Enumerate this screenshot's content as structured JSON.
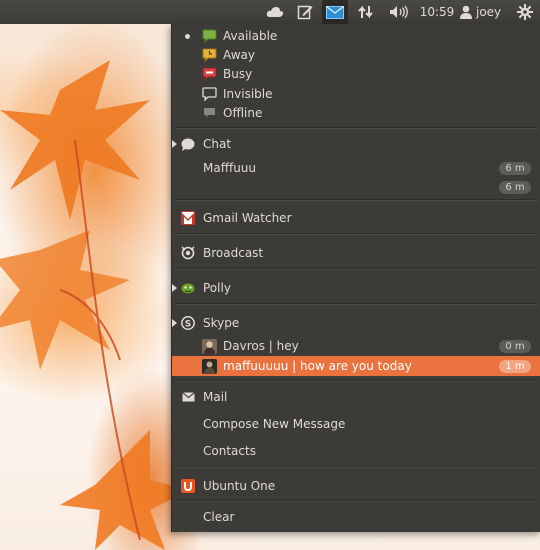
{
  "panel": {
    "clock": "10:59",
    "user": "joey",
    "icons": [
      "cloud-icon",
      "compose-icon",
      "envelope-icon",
      "network-icon",
      "volume-icon",
      "user-icon",
      "gear-icon"
    ]
  },
  "status": {
    "items": [
      {
        "label": "Available",
        "icon": "available-status-icon",
        "color": "#7cb342",
        "selected": true
      },
      {
        "label": "Away",
        "icon": "away-status-icon",
        "color": "#e3b33c"
      },
      {
        "label": "Busy",
        "icon": "busy-status-icon",
        "color": "#d64545"
      },
      {
        "label": "Invisible",
        "icon": "invisible-status-icon",
        "color": "#dfdbd2"
      },
      {
        "label": "Offline",
        "icon": "offline-status-icon",
        "color": "#8a8780"
      }
    ]
  },
  "chat": {
    "label": "Chat",
    "contact": "Mafffuuu",
    "badge1": "6 m",
    "badge2": "6 m"
  },
  "gmail": {
    "label": "Gmail Watcher"
  },
  "broadcast": {
    "label": "Broadcast"
  },
  "polly": {
    "label": "Polly"
  },
  "skype": {
    "label": "Skype",
    "messages": [
      {
        "text": "Davros | hey",
        "time": "0 m"
      },
      {
        "text": "maffuuuuu | how are you today",
        "time": "1 m",
        "highlighted": true
      }
    ]
  },
  "mail": {
    "label": "Mail",
    "compose": "Compose New Message",
    "contacts": "Contacts"
  },
  "ubuntu_one": {
    "label": "Ubuntu One"
  },
  "clear": {
    "label": "Clear"
  },
  "colors": {
    "accent": "#e9723f",
    "menu_bg": "#3c3b37",
    "panel_bg": "#3c3b37"
  }
}
